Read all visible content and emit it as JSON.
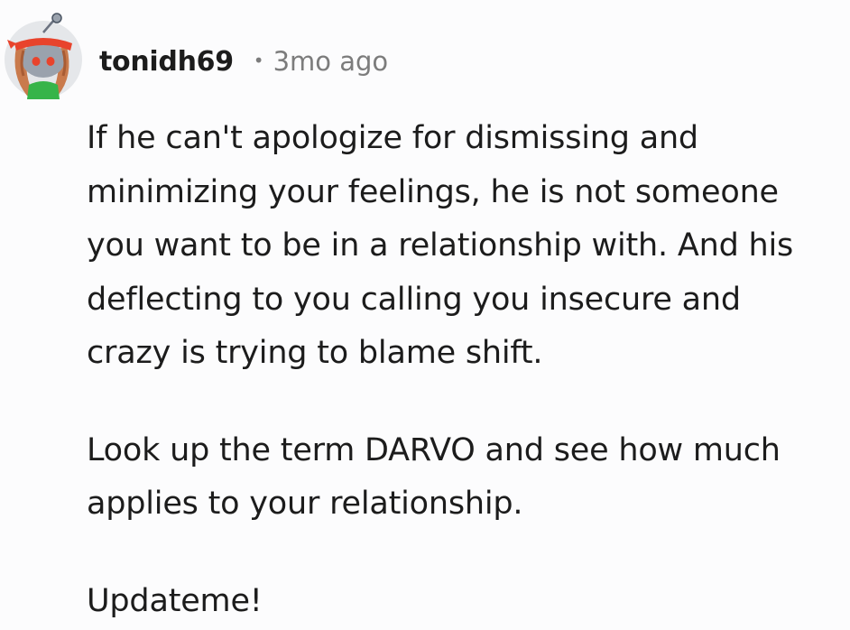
{
  "comment": {
    "username": "tonidh69",
    "separator": "•",
    "timestamp": "3mo ago",
    "paragraphs": [
      "If he can't apologize for dismissing and\nminimizing your feelings, he is not someone\nyou want to be in a relationship with. And his\ndeflecting to you calling you insecure and\ncrazy is trying to blame shift.",
      "Look up the term DARVO and see how much\napplies to your relationship.",
      "Updateme!"
    ]
  },
  "avatar": {
    "icon": "snoo-avatar-icon",
    "colors": {
      "background": "#e5e7ea",
      "headband": "#e8432c",
      "hair": "#c97a4c",
      "face": "#9aa2ad",
      "shirt": "#36b449"
    }
  },
  "colors": {
    "text": "#1c1c1c",
    "meta": "#7c7c7c"
  }
}
